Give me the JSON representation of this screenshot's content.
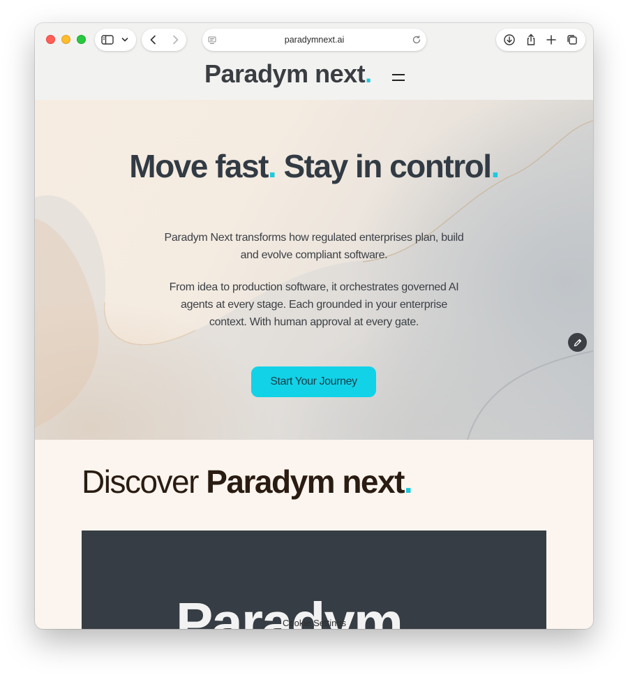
{
  "browser": {
    "url": "paradymnext.ai",
    "icons": [
      "sidebar-icon",
      "chevron-down-icon",
      "back-icon",
      "forward-icon",
      "page-icon",
      "reload-icon",
      "download-icon",
      "share-icon",
      "plus-icon",
      "tabs-icon"
    ]
  },
  "site": {
    "logo_text": "Paradym next",
    "logo_dot": ".",
    "accent_color": "#1ec9dd"
  },
  "hero": {
    "title_part1": "Move fast",
    "title_part2": " Stay in control",
    "dot": ".",
    "paragraph1": "Paradym Next transforms how regulated enterprises plan, build and evolve compliant software.",
    "paragraph2": "From idea to production software, it orchestrates governed AI agents at every stage. Each grounded in your enterprise context. With human approval at every gate.",
    "cta_label": "Start Your Journey",
    "cta_color": "#12d2e8"
  },
  "discover": {
    "title_light": "Discover ",
    "title_bold": "Paradym next",
    "dot": ".",
    "video_logo": "Paradym"
  },
  "cookie": {
    "label": "Cookie Settings"
  }
}
